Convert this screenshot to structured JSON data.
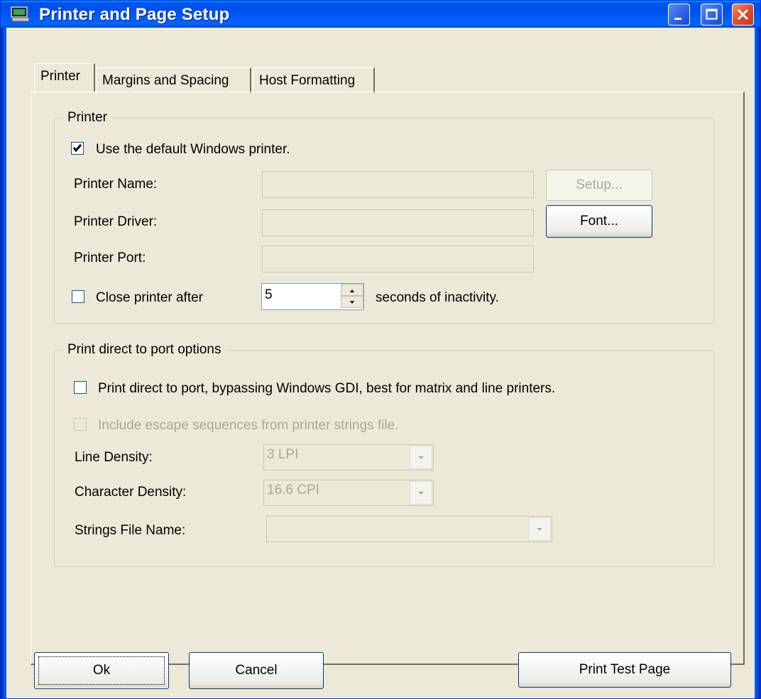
{
  "window": {
    "title": "Printer and Page Setup"
  },
  "tabs": [
    {
      "label": "Printer",
      "active": true
    },
    {
      "label": "Margins and Spacing",
      "active": false
    },
    {
      "label": "Host Formatting",
      "active": false
    }
  ],
  "printer_group": {
    "legend": "Printer",
    "use_default_label": "Use the default Windows printer.",
    "use_default_checked": true,
    "printer_name_label": "Printer Name:",
    "printer_name_value": "",
    "printer_driver_label": "Printer Driver:",
    "printer_driver_value": "",
    "printer_port_label": "Printer Port:",
    "printer_port_value": "",
    "setup_button": "Setup...",
    "font_button": "Font...",
    "close_after_label": "Close printer after",
    "close_after_checked": false,
    "close_after_seconds": "5",
    "close_after_suffix": "seconds of inactivity."
  },
  "direct_group": {
    "legend": "Print direct to port options",
    "direct_label": "Print direct to port, bypassing Windows GDI, best for matrix and line printers.",
    "direct_checked": false,
    "escape_label": "Include escape sequences from printer strings file.",
    "escape_checked": false,
    "line_density_label": "Line Density:",
    "line_density_value": "3 LPI",
    "char_density_label": "Character Density:",
    "char_density_value": "16.6 CPI",
    "strings_file_label": "Strings File Name:",
    "strings_file_value": ""
  },
  "buttons": {
    "ok": "Ok",
    "cancel": "Cancel",
    "print_test": "Print Test Page"
  },
  "colors": {
    "titlebar": "#0054e3",
    "dialog_face": "#ece9d8",
    "close_button": "#e04a23"
  }
}
